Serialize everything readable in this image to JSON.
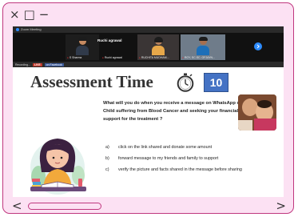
{
  "window": {
    "controls": {
      "close": "×",
      "maximize": "□",
      "minimize": "−"
    }
  },
  "zoom": {
    "app_title": "Zoom Meeting",
    "participants": [
      {
        "name": "S Sharma"
      },
      {
        "name": "Ruchi agrawal"
      },
      {
        "name": "RUCHITA MUDHAM..."
      },
      {
        "name": "ROY, SC.SC. OFJAYN..."
      }
    ],
    "speaker_name": "Ruchi agrawal",
    "recording_label": "Recording...",
    "live_label": "LIVE",
    "facebook_label": "on Facebook"
  },
  "slide": {
    "title": "Assessment Time",
    "timer_value": "10",
    "question": "What will you do when you receive a message on WhatsApp of a Child suffering from Blood Cancer and seeking your financial support for the treatment ?",
    "options": [
      {
        "key": "a)",
        "text": "click on the link shared and donate some amount"
      },
      {
        "key": "b)",
        "text": "forward message to my friends and family to support"
      },
      {
        "key": "c)",
        "text": "verify the picture and facts shared in the message before sharing"
      }
    ]
  },
  "scroll": {
    "left_arrow": "<",
    "right_arrow": ">"
  },
  "colors": {
    "frame_accent": "#c0387f",
    "frame_bg": "#fce1f3",
    "timer_box": "#4472c4"
  }
}
